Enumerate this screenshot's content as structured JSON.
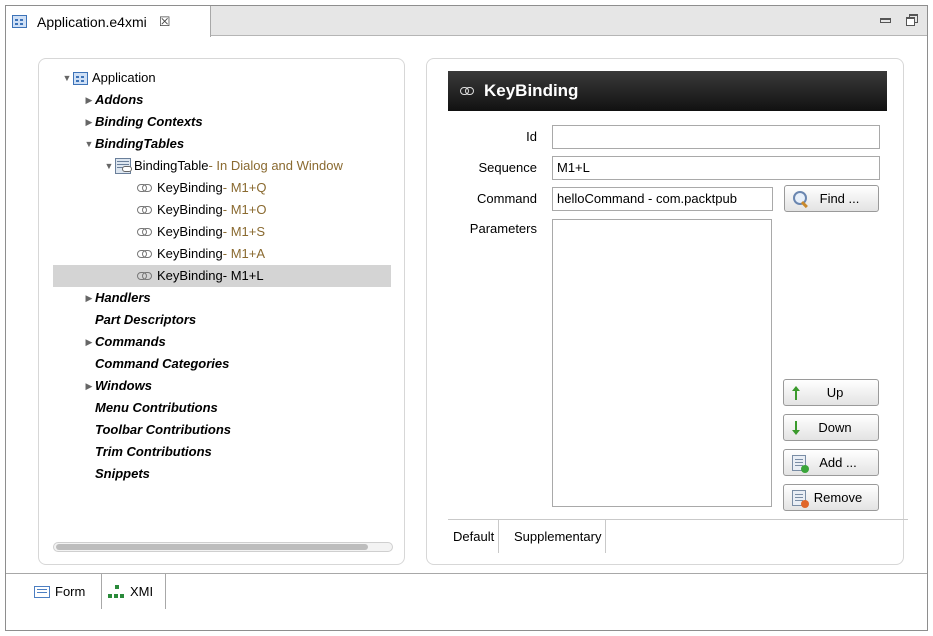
{
  "editor_tab": {
    "label": "Application.e4xmi",
    "close": "☒"
  },
  "tree": {
    "rows": [
      {
        "label": "Application",
        "suffix": ""
      },
      {
        "label": "Addons",
        "suffix": ""
      },
      {
        "label": "Binding Contexts",
        "suffix": ""
      },
      {
        "label": "BindingTables",
        "suffix": ""
      },
      {
        "label": "BindingTable",
        "suffix": " - In Dialog and Window"
      },
      {
        "label": "KeyBinding",
        "suffix": " - M1+Q"
      },
      {
        "label": "KeyBinding",
        "suffix": " - M1+O"
      },
      {
        "label": "KeyBinding",
        "suffix": " - M1+S"
      },
      {
        "label": "KeyBinding",
        "suffix": " - M1+A"
      },
      {
        "label": "KeyBinding",
        "suffix": " - M1+L"
      },
      {
        "label": "Handlers",
        "suffix": ""
      },
      {
        "label": "Part Descriptors",
        "suffix": ""
      },
      {
        "label": "Commands",
        "suffix": ""
      },
      {
        "label": "Command Categories",
        "suffix": ""
      },
      {
        "label": "Windows",
        "suffix": ""
      },
      {
        "label": "Menu Contributions",
        "suffix": ""
      },
      {
        "label": "Toolbar Contributions",
        "suffix": ""
      },
      {
        "label": "Trim Contributions",
        "suffix": ""
      },
      {
        "label": "Snippets",
        "suffix": ""
      }
    ],
    "selected_index": 9
  },
  "detail": {
    "title": "KeyBinding",
    "id_label": "Id",
    "id_value": "",
    "sequence_label": "Sequence",
    "sequence_value": "M1+L",
    "command_label": "Command",
    "command_value": "helloCommand - com.packtpub",
    "find_label": "Find ...",
    "parameters_label": "Parameters",
    "buttons": {
      "up": "Up",
      "down": "Down",
      "add": "Add ...",
      "remove": "Remove"
    },
    "tabs": [
      "Default",
      "Supplementary"
    ]
  },
  "bottom_tabs": [
    "Form",
    "XMI"
  ],
  "colors": {
    "suffix": "#8a6a30",
    "selection": "#d4d4d4",
    "header_bg": "#1a1a1a",
    "arrow": "#3a9a2c"
  }
}
